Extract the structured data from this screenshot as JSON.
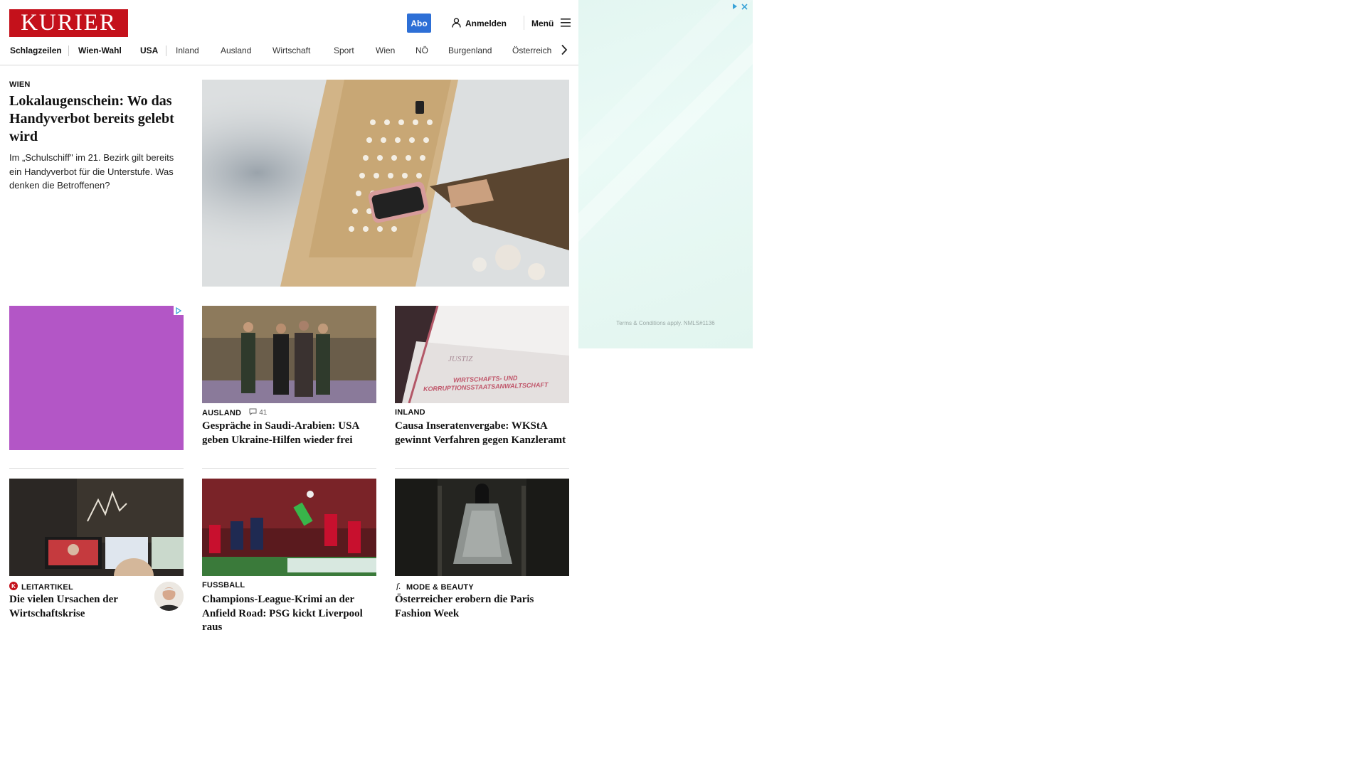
{
  "header": {
    "logo": "KURIER",
    "abo_label": "Abo",
    "login_label": "Anmelden",
    "menu_label": "Menü",
    "icons": {
      "login": "user-icon",
      "menu": "hamburger-icon"
    }
  },
  "nav": {
    "items": [
      "Schlagzeilen",
      "Wien-Wahl",
      "USA",
      "Inland",
      "Ausland",
      "Wirtschaft",
      "Sport",
      "Wien",
      "NÖ",
      "Burgenland",
      "Österreich"
    ],
    "more_icon": "chevron-right-icon"
  },
  "lead": {
    "rubric": "WIEN",
    "title": "Lokalaugenschein: Wo das Handyverbot bereits gelebt wird",
    "teaser": "Im „Schulschiff\" im 21. Bezirk gilt bereits ein Handyverbot für die Unterstufe. Was denken die Betroffenen?"
  },
  "cards": [
    {
      "rubric": "AUSLAND",
      "comments": "41",
      "title": "Gespräche in Saudi-Arabien: USA geben Ukraine-Hilfen wieder frei"
    },
    {
      "rubric": "INLAND",
      "title": "Causa Inseratenvergabe: WKStA gewinnt Verfahren gegen Kanzleramt",
      "image_text": "WIRTSCHAFTS- UND KORRUPTIONSSTAATSANWALTSCHAFT"
    },
    {
      "rubric": "LEITARTIKEL",
      "title": "Die vielen Ursachen der Wirtschaftskrise"
    },
    {
      "rubric": "FUSSBALL",
      "title": "Champions-League-Krimi an der Anfield Road: PSG kickt Liverpool raus"
    },
    {
      "rubric": "MODE & BEAUTY",
      "title": "Österreicher erobern die Paris Fashion Week"
    }
  ],
  "ads": {
    "right_terms": "Terms & Conditions apply. NMLS#1136"
  },
  "colors": {
    "brand": "#c4111b",
    "abo": "#2d6fd6",
    "ad_left": "#b356c6",
    "ad_right": "#e3f6f1"
  }
}
